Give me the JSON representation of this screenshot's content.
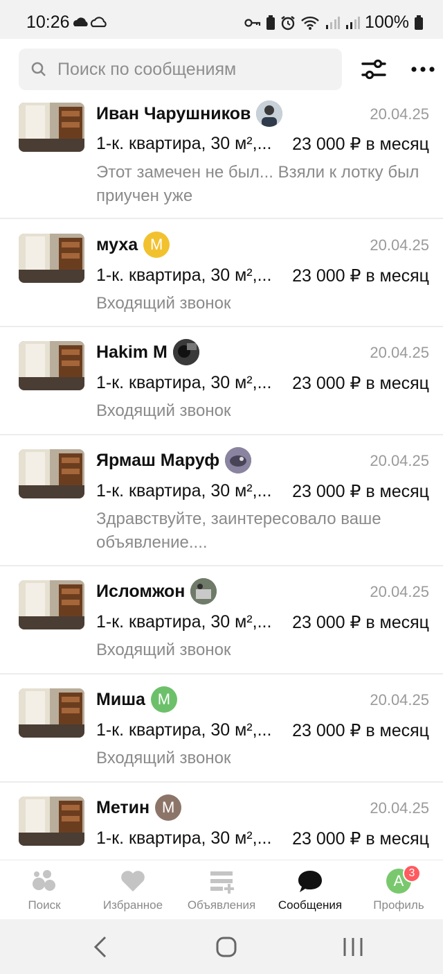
{
  "status_bar": {
    "time": "10:26",
    "battery_pct": "100%"
  },
  "search": {
    "placeholder": "Поиск по сообщениям"
  },
  "chats": [
    {
      "name": "Иван Чарушников",
      "avatar_type": "photo",
      "avatar_color": "#7a8aa0",
      "date": "20.04.25",
      "title": "1-к. квартира, 30 м²,...",
      "price": "23 000 ₽ в месяц",
      "message": "Этот замечен не был... Взяли к лотку был приучен уже"
    },
    {
      "name": "муха",
      "avatar_type": "letter",
      "avatar_letter": "М",
      "avatar_color": "#f2c12e",
      "date": "20.04.25",
      "title": "1-к. квартира, 30 м²,...",
      "price": "23 000 ₽ в месяц",
      "message": "Входящий звонок"
    },
    {
      "name": "Hakim M",
      "avatar_type": "photo",
      "avatar_color": "#2a2a2a",
      "date": "20.04.25",
      "title": "1-к. квартира, 30 м²,...",
      "price": "23 000 ₽ в месяц",
      "message": "Входящий звонок"
    },
    {
      "name": "Ярмаш Маруф",
      "avatar_type": "photo",
      "avatar_color": "#6a6478",
      "date": "20.04.25",
      "title": "1-к. квартира, 30 м²,...",
      "price": "23 000 ₽ в месяц",
      "message": "Здравствуйте, заинтересовало ваше объявление...."
    },
    {
      "name": "Исломжон",
      "avatar_type": "photo",
      "avatar_color": "#5a6a5a",
      "date": "20.04.25",
      "title": "1-к. квартира, 30 м²,...",
      "price": "23 000 ₽ в месяц",
      "message": "Входящий звонок"
    },
    {
      "name": "Миша",
      "avatar_type": "letter",
      "avatar_letter": "М",
      "avatar_color": "#6cc06a",
      "date": "20.04.25",
      "title": "1-к. квартира, 30 м²,...",
      "price": "23 000 ₽ в месяц",
      "message": "Входящий звонок"
    },
    {
      "name": "Метин",
      "avatar_type": "letter",
      "avatar_letter": "М",
      "avatar_color": "#8c7568",
      "date": "20.04.25",
      "title": "1-к. квартира, 30 м²,...",
      "price": "23 000 ₽ в месяц",
      "message": ""
    }
  ],
  "bottom_nav": {
    "items": [
      {
        "label": "Поиск",
        "icon": "search-bubbles-icon"
      },
      {
        "label": "Избранное",
        "icon": "heart-icon"
      },
      {
        "label": "Объявления",
        "icon": "add-listing-icon"
      },
      {
        "label": "Сообщения",
        "icon": "chat-bubble-icon"
      },
      {
        "label": "Профиль",
        "icon": "profile-avatar-icon"
      }
    ],
    "active_index": 3,
    "profile_letter": "А",
    "profile_badge": "3"
  },
  "colors": {
    "accent_badge": "#ff5a5f",
    "muted_text": "#8a8a8a"
  }
}
